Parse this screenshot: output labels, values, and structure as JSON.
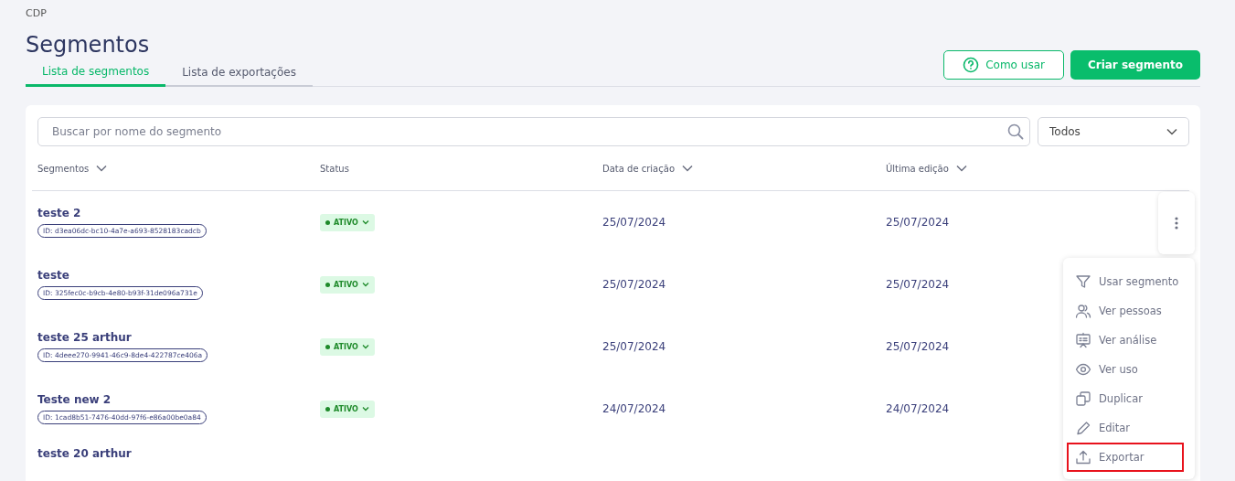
{
  "breadcrumb": "CDP",
  "title": "Segmentos",
  "tabs": [
    {
      "label": "Lista de segmentos",
      "selected": true
    },
    {
      "label": "Lista de exportações",
      "selected": false
    }
  ],
  "actions": {
    "help_button": "Como usar",
    "create_button": "Criar segmento"
  },
  "search": {
    "placeholder": "Buscar por nome do segmento"
  },
  "filter": {
    "value": "Todos"
  },
  "table": {
    "columns": [
      {
        "label": "Segmentos",
        "sortable": true
      },
      {
        "label": "Status",
        "sortable": false
      },
      {
        "label": "Data de criação",
        "sortable": true
      },
      {
        "label": "Última edição",
        "sortable": true
      }
    ],
    "rows": [
      {
        "name": "teste 2",
        "id": "ID: d3ea06dc-bc10-4a7e-a693-8528183cadcb",
        "status": "ATIVO",
        "created": "25/07/2024",
        "edited": "25/07/2024",
        "menu_open": true
      },
      {
        "name": "teste",
        "id": "ID: 325fec0c-b9cb-4e80-b93f-31de096a731e",
        "status": "ATIVO",
        "created": "25/07/2024",
        "edited": "25/07/2024",
        "menu_open": false
      },
      {
        "name": "teste 25 arthur",
        "id": "ID: 4deee270-9941-46c9-8de4-422787ce406a",
        "status": "ATIVO",
        "created": "25/07/2024",
        "edited": "25/07/2024",
        "menu_open": false
      },
      {
        "name": "Teste new 2",
        "id": "ID: 1cad8b51-7476-40dd-97f6-e86a00be0a84",
        "status": "ATIVO",
        "created": "24/07/2024",
        "edited": "24/07/2024",
        "menu_open": false
      },
      {
        "name": "teste 20 arthur",
        "menu_open": false
      }
    ]
  },
  "row_menu": [
    {
      "kind": "filter",
      "label": "Usar segmento",
      "highlighted": false
    },
    {
      "kind": "people",
      "label": "Ver pessoas",
      "highlighted": false
    },
    {
      "kind": "analysis",
      "label": "Ver análise",
      "highlighted": false
    },
    {
      "kind": "eye",
      "label": "Ver uso",
      "highlighted": false
    },
    {
      "kind": "copy",
      "label": "Duplicar",
      "highlighted": false
    },
    {
      "kind": "pencil",
      "label": "Editar",
      "highlighted": false
    },
    {
      "kind": "upload",
      "label": "Exportar",
      "highlighted": true
    }
  ]
}
